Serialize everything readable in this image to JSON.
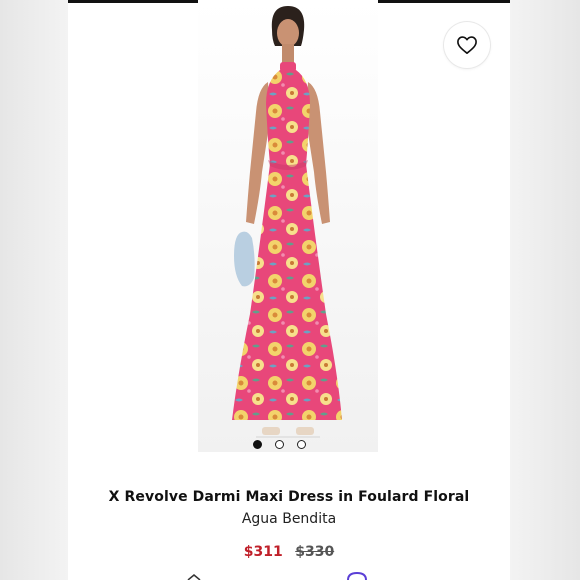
{
  "product": {
    "title": "X Revolve Darmi Maxi Dress in Foulard Floral",
    "brand": "Agua Bendita",
    "sale_price": "$311",
    "original_price": "$330",
    "sale_color": "#c0202a"
  },
  "gallery": {
    "total_images": 3,
    "active_index": 0
  },
  "icons": {
    "wishlist": "heart-outline-icon"
  },
  "colors": {
    "dress_pink": "#e8477a",
    "flower_yellow": "#f3d36b",
    "text_dark": "#111111"
  }
}
